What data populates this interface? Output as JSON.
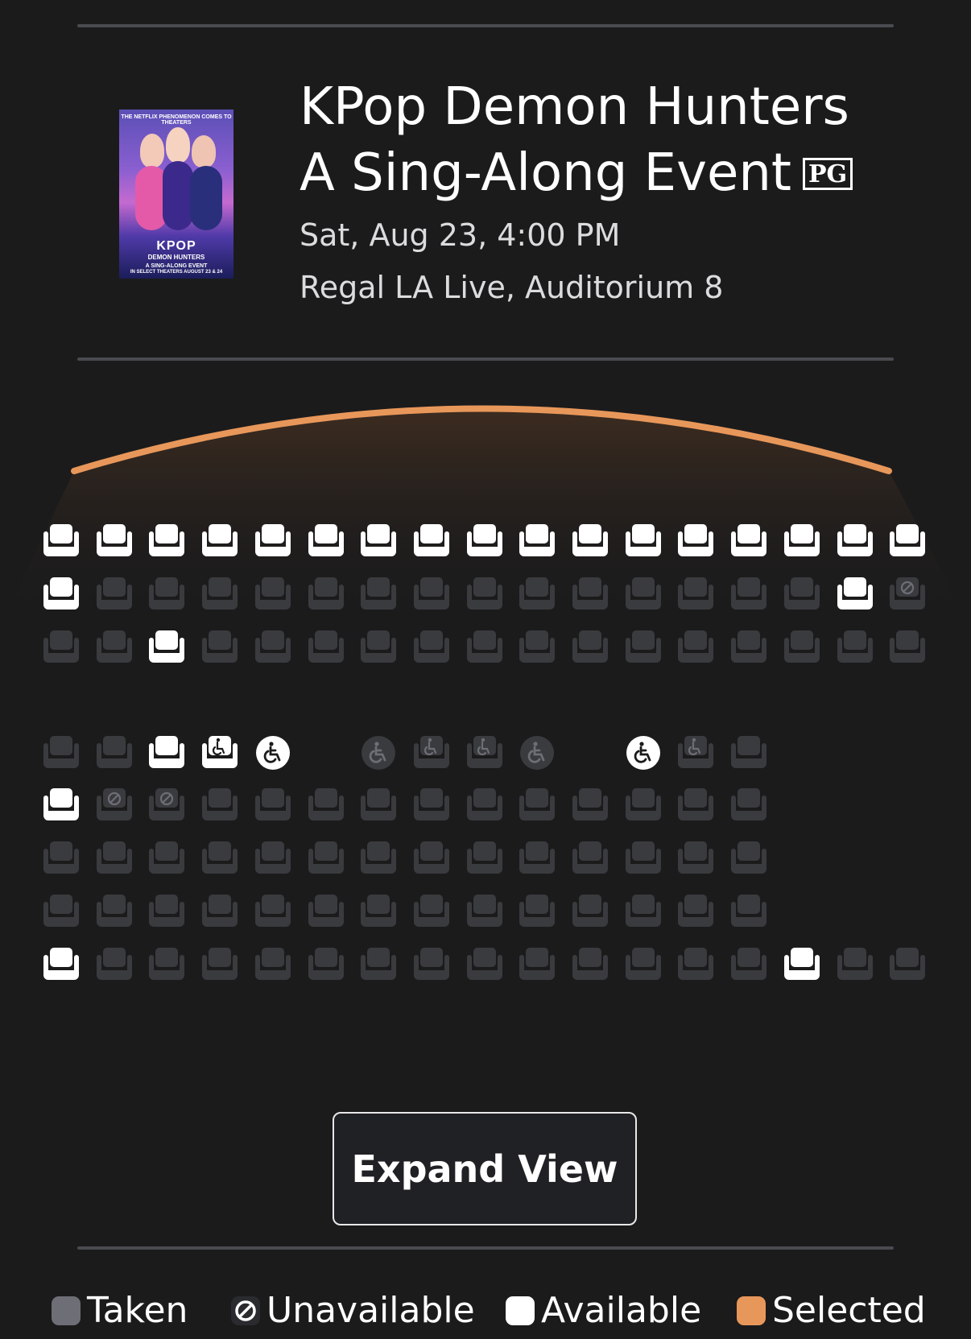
{
  "movie": {
    "title": "KPop Demon Hunters A Sing-Along Event",
    "rating": "PG",
    "datetime": "Sat, Aug 23, 4:00 PM",
    "venue": "Regal LA Live, Auditorium 8",
    "poster": {
      "top_text": "THE NETFLIX PHENOMENON COMES TO THEATERS",
      "title": "KPOP",
      "subtitle": "DEMON HUNTERS",
      "tagline": "A SING-ALONG EVENT",
      "dates": "IN SELECT THEATERS AUGUST 23 & 24"
    }
  },
  "colors": {
    "background": "#1b1b1c",
    "taken": "#6d6e76",
    "available": "#ffffff",
    "selected": "#e8975a",
    "screen": "#e8975a"
  },
  "seat_map": {
    "rows": [
      {
        "seats": [
          "A",
          "A",
          "A",
          "A",
          "A",
          "A",
          "A",
          "A",
          "A",
          "A",
          "A",
          "A",
          "A",
          "A",
          "A",
          "A",
          "A"
        ]
      },
      {
        "seats": [
          "A",
          "T",
          "T",
          "T",
          "T",
          "T",
          "T",
          "T",
          "T",
          "T",
          "T",
          "T",
          "T",
          "T",
          "T",
          "A",
          "U"
        ]
      },
      {
        "seats": [
          "T",
          "T",
          "A",
          "T",
          "T",
          "T",
          "T",
          "T",
          "T",
          "T",
          "T",
          "T",
          "T",
          "T",
          "T",
          "T",
          "T"
        ]
      },
      {
        "seats": [
          "T",
          "T",
          "A",
          "CA",
          "WA",
          "-",
          "WT",
          "CT",
          "CT",
          "WT",
          "-",
          "WA",
          "CT",
          "T",
          "-",
          "-",
          "-"
        ]
      },
      {
        "seats": [
          "A",
          "U",
          "U",
          "T",
          "T",
          "T",
          "T",
          "T",
          "T",
          "T",
          "T",
          "T",
          "T",
          "T",
          "-",
          "-",
          "-"
        ]
      },
      {
        "seats": [
          "T",
          "T",
          "T",
          "T",
          "T",
          "T",
          "T",
          "T",
          "T",
          "T",
          "T",
          "T",
          "T",
          "T",
          "-",
          "-",
          "-"
        ]
      },
      {
        "seats": [
          "T",
          "T",
          "T",
          "T",
          "T",
          "T",
          "T",
          "T",
          "T",
          "T",
          "T",
          "T",
          "T",
          "T",
          "-",
          "-",
          "-"
        ]
      },
      {
        "seats": [
          "A",
          "T",
          "T",
          "T",
          "T",
          "T",
          "T",
          "T",
          "T",
          "T",
          "T",
          "T",
          "T",
          "T",
          "A",
          "T",
          "T"
        ]
      }
    ],
    "legend_codes": {
      "A": "available",
      "T": "taken",
      "U": "unavailable",
      "CA": "companion-available",
      "CT": "companion-taken",
      "WA": "wheelchair-available",
      "WT": "wheelchair-taken",
      "-": "no seat"
    }
  },
  "actions": {
    "expand_view": "Expand View"
  },
  "legend": [
    {
      "label": "Taken",
      "kind": "taken"
    },
    {
      "label": "Unavailable",
      "kind": "unavailable"
    },
    {
      "label": "Available",
      "kind": "available"
    },
    {
      "label": "Selected",
      "kind": "selected"
    }
  ]
}
